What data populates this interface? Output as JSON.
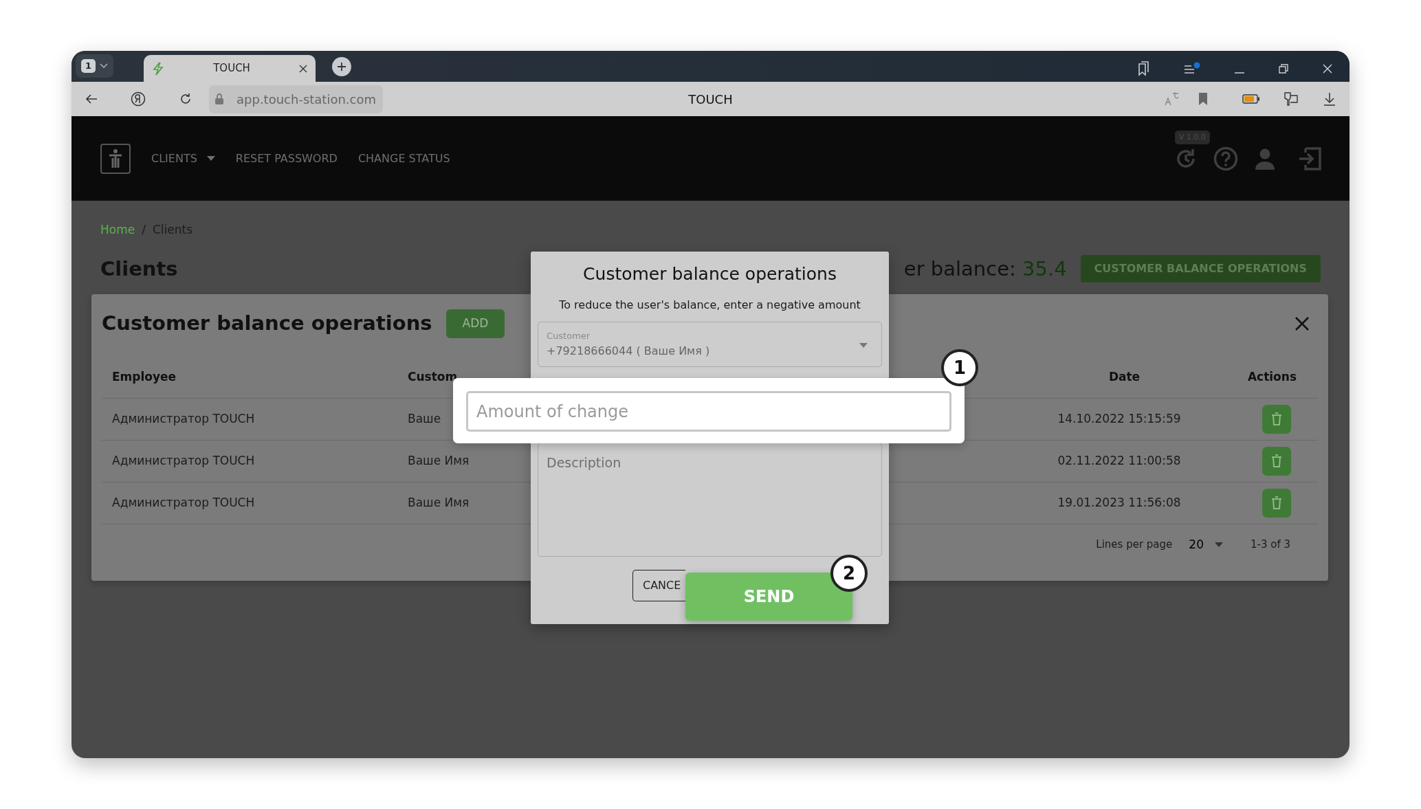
{
  "browser": {
    "tab_count": "1",
    "tabs": [
      {
        "title": "TOUCH",
        "selected": true
      }
    ],
    "address": "app.touch-station.com",
    "page_title": "TOUCH"
  },
  "header": {
    "nav": [
      {
        "label": "CLIENTS",
        "has_menu": true
      },
      {
        "label": "RESET PASSWORD",
        "has_menu": false
      },
      {
        "label": "CHANGE STATUS",
        "has_menu": false
      }
    ],
    "version": "V 1.0.0"
  },
  "breadcrumb": [
    {
      "label": "Home",
      "link": true
    },
    {
      "label": "Clients",
      "link": false
    }
  ],
  "breadcrumb_separator": "/",
  "page_title": "Clients",
  "balance": {
    "label": "er balance:",
    "value": "35.4"
  },
  "balance_button": "CUSTOMER BALANCE OPERATIONS",
  "panel": {
    "title": "Customer balance operations",
    "add_button": "ADD",
    "columns": [
      "Employee",
      "Custom",
      "Date",
      "Actions"
    ],
    "rows": [
      {
        "employee": "Администратор TOUCH",
        "customer": "Ваше",
        "date": "14.10.2022 15:15:59"
      },
      {
        "employee": "Администратор TOUCH",
        "customer": "Ваше Имя",
        "date": "02.11.2022 11:00:58"
      },
      {
        "employee": "Администратор TOUCH",
        "customer": "Ваше Имя",
        "date": "19.01.2023 11:56:08"
      }
    ],
    "pagination": {
      "label": "Lines per page",
      "per_page": "20",
      "range": "1-3 of 3"
    }
  },
  "dialog": {
    "title": "Customer balance operations",
    "hint": "To reduce the user's balance, enter a negative amount",
    "customer": {
      "label": "Customer",
      "value": "+79218666044 ( Ваше Имя )"
    },
    "amount": {
      "placeholder": "Amount of change"
    },
    "description": {
      "placeholder": "Description"
    },
    "buttons": [
      {
        "label": "CANCE",
        "kind": "outline"
      },
      {
        "label": "SEND",
        "kind": "primary"
      }
    ]
  },
  "callouts": [
    "1",
    "2"
  ]
}
